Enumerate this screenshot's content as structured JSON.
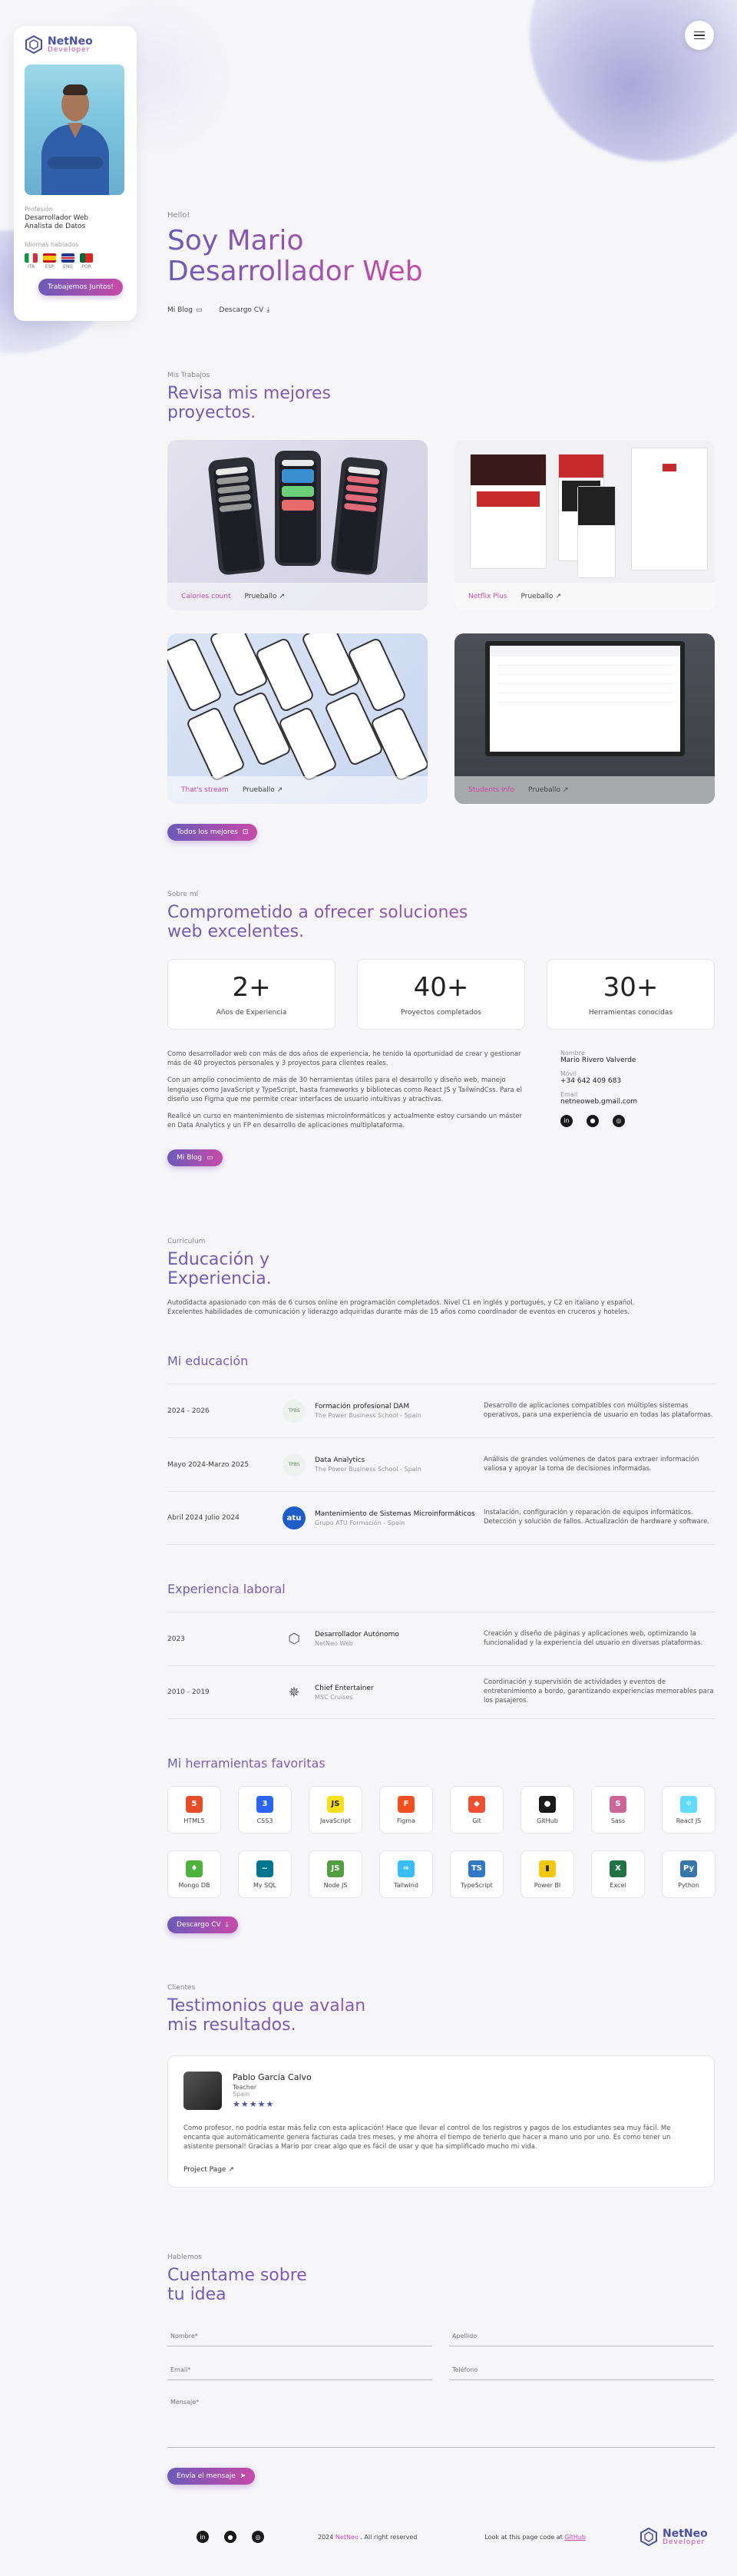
{
  "profile": {
    "logo_line1": "NetNeo",
    "logo_line2": "Developer",
    "role_label": "Profesión",
    "role": "Desarrollador Web\nAnalista de Datos",
    "languages_label": "Idiomas hablados",
    "languages": [
      {
        "code": "ITA",
        "flag": "italy-flag-icon"
      },
      {
        "code": "ESP",
        "flag": "spain-flag-icon"
      },
      {
        "code": "ENG",
        "flag": "uk-flag-icon"
      },
      {
        "code": "POR",
        "flag": "portugal-flag-icon"
      }
    ],
    "cta": "Trabajemos Juntos!"
  },
  "hero": {
    "hello": "Hello!",
    "title_line1": "Soy Mario",
    "title_line2": "Desarrollador Web",
    "link_blog": "Mi Blog",
    "link_cv": "Descargo CV"
  },
  "projects": {
    "kicker": "Mis Trabajos",
    "title_line1": "Revisa mis mejores",
    "title_line2": "proyectos.",
    "items": [
      {
        "name": "Calories count",
        "link": "Prueballo"
      },
      {
        "name": "Netflix Plus",
        "link": "Prueballo"
      },
      {
        "name": "That's stream",
        "link": "Prueballo"
      },
      {
        "name": "Students Info",
        "link": "Prueballo"
      }
    ],
    "all_button": "Todos los mejores"
  },
  "about": {
    "kicker": "Sobre mí",
    "title_line1": "Comprometido a ofrecer soluciones",
    "title_line2": "web excelentes.",
    "stats": [
      {
        "value": "2+",
        "label": "Años de Experiencia"
      },
      {
        "value": "40+",
        "label": "Proyectos completados"
      },
      {
        "value": "30+",
        "label": "Herramientas conocidas"
      }
    ],
    "paragraphs": [
      "Como desarrollador web con más de dos años de experiencia, he tenido la oportunidad de crear y gestionar más de 40 proyectos personales y 3 proyectos para clientes reales.",
      "Con un amplio conocimiento de más de 30 herramientas útiles para el desarrollo y diseño web, manejo lenguajes como JavaScript y TypeScript, hasta frameworks y bibliotecas como React JS y TailwindCss. Para el diseño uso Figma que me permite crear interfaces de usuario intuitivas y atractivas.",
      "Realicé un curso en mantenimiento de sistemas microinformáticos y actualmente estoy cursando un máster en Data Analytics y un FP en desarrollo de aplicaciones multiplataforma."
    ],
    "contact": {
      "name_label": "Nombre",
      "name": "Mario Rivero Valverde",
      "phone_label": "Móvil",
      "phone": "+34 642 409 683",
      "email_label": "Email",
      "email": "netneoweb.gmail.com"
    },
    "blog_button": "Mi Blog"
  },
  "curriculum": {
    "kicker": "Curriculum",
    "title_line1": "Educación y",
    "title_line2": "Experiencia.",
    "intro": "Autodidacta apasionado con más de 6 cursos online en programación completados. Nivel C1 en inglés y portugués, y C2 en italiano y español. Excelentes habilidades de comunicación y liderazgo adquiridas durante más de 15 años como coordinador de eventos en cruceros y hoteles.",
    "education_title": "Mi educación",
    "education": [
      {
        "date": "2024 - 2026",
        "logo": "TPBS",
        "name": "Formación profesional DAM",
        "school": "The Power Business School - Spain",
        "desc": "Desarrollo de aplicaciones compatibles con múltiples sistemas operativos, para una experiencia de usuario en todas las plataformas."
      },
      {
        "date": "Mayo 2024-Marzo 2025",
        "logo": "TPBS",
        "name": "Data Analytics",
        "school": "The Power Business School - Spain",
        "desc": "Análisis de grandes volúmenes de datos para extraer información valiosa y apoyar la toma de decisiones informadas."
      },
      {
        "date": "Abril 2024 Julio 2024",
        "logo": "atu",
        "name": "Mantenimiento de Sistemas Microinformáticos",
        "school": "Grupo ATU Formación - Spain",
        "desc": "Instalación, configuración y reparación de equipos informáticos. Detección y solución de fallos. Actualización de hardware y software."
      }
    ],
    "experience_title": "Experiencia laboral",
    "experience": [
      {
        "date": "2023",
        "name": "Desarrollador Autónomo",
        "school": "NetNeo Web",
        "desc": "Creación y diseño de páginas y aplicaciones web, optimizando la funcionalidad y la experiencia del usuario en diversas plataformas."
      },
      {
        "date": "2010 - 2019",
        "name": "Chief Entertainer",
        "school": "MSC Cruises",
        "desc": "Coordinación y supervisión de actividades y eventos de entretenimiento a bordo, garantizando experiencias memorables para los pasajeros."
      }
    ],
    "tools_title": "Mi herramientas favoritas",
    "tools": [
      {
        "label": "HTML5",
        "icon": "html5-icon",
        "color": "#e44d26",
        "glyph": "5"
      },
      {
        "label": "CSS3",
        "icon": "css3-icon",
        "color": "#2965f1",
        "glyph": "3"
      },
      {
        "label": "JavaScript",
        "icon": "javascript-icon",
        "color": "#f7df1e",
        "glyph": "JS"
      },
      {
        "label": "Figma",
        "icon": "figma-icon",
        "color": "#f24e1e",
        "glyph": "F"
      },
      {
        "label": "Git",
        "icon": "git-icon",
        "color": "#f05032",
        "glyph": "◆"
      },
      {
        "label": "GitHub",
        "icon": "github-icon",
        "color": "#1a1a1a",
        "glyph": "●"
      },
      {
        "label": "Sass",
        "icon": "sass-icon",
        "color": "#cc6699",
        "glyph": "S"
      },
      {
        "label": "React JS",
        "icon": "react-icon",
        "color": "#61dafb",
        "glyph": "⚛"
      },
      {
        "label": "Mongo DB",
        "icon": "mongodb-icon",
        "color": "#4db33d",
        "glyph": "♦"
      },
      {
        "label": "My SQL",
        "icon": "mysql-icon",
        "color": "#00758f",
        "glyph": "~"
      },
      {
        "label": "Node JS",
        "icon": "nodejs-icon",
        "color": "#539e43",
        "glyph": "JS"
      },
      {
        "label": "Tailwind",
        "icon": "tailwind-icon",
        "color": "#38bdf8",
        "glyph": "≈"
      },
      {
        "label": "TypeScript",
        "icon": "typescript-icon",
        "color": "#3178c6",
        "glyph": "TS"
      },
      {
        "label": "Power BI",
        "icon": "powerbi-icon",
        "color": "#f2c811",
        "glyph": "▮"
      },
      {
        "label": "Excel",
        "icon": "excel-icon",
        "color": "#217346",
        "glyph": "X"
      },
      {
        "label": "Python",
        "icon": "python-icon",
        "color": "#3776ab",
        "glyph": "Py"
      }
    ],
    "cv_button": "Descargo CV"
  },
  "testimonials": {
    "kicker": "Clientes",
    "title_line1": "Testimonios que avalan",
    "title_line2": "mis resultados.",
    "card": {
      "name": "Pablo García Calvo",
      "role": "Teacher",
      "location": "Spain",
      "stars": "★★★★★",
      "text": "Como profesor, no podría estar más feliz con esta aplicación! Hace que llevar el control de los registros y pagos de los estudiantes sea muy fácil. Me encanta que automáticamente genera facturas cada tres meses, y me ahorra el tiempo de tenerlo que hacer a mano uno por uno. Es como tener un asistente personal! Gracias a Mario por crear algo que es fácil de usar y que ha simplificado mucho mi vida.",
      "link": "Project Page"
    }
  },
  "contact_form": {
    "kicker": "Hablemos",
    "title_line1": "Cuentame sobre",
    "title_line2": "tu idea",
    "name_ph": "Nombre*",
    "surname_ph": "Apellido",
    "email_ph": "Email*",
    "phone_ph": "Teléfono",
    "message_ph": "Mensaje*",
    "send": "Envía el mensaje"
  },
  "footer": {
    "copy_prefix": "2024 ",
    "copy_brand": "NetNeo",
    "copy_suffix": " . All right reserved",
    "look_prefix": "Look at this page code at ",
    "look_link": "GitHub"
  }
}
